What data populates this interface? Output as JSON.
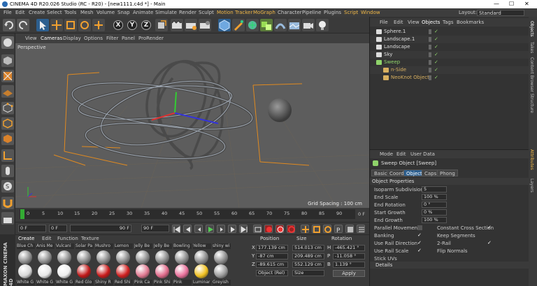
{
  "window": {
    "title": "CINEMA 4D R20.026 Studio (RC - R20) - [new1111.c4d *] - Main",
    "minimize": "—",
    "maximize": "☐",
    "close": "✕"
  },
  "menubar": {
    "items": [
      "File",
      "Edit",
      "Create",
      "Select",
      "Tools",
      "Mesh",
      "Volume",
      "Snap",
      "Animate",
      "Simulate",
      "Render",
      "Sculpt",
      "Motion Tracker",
      "MoGraph",
      "Character",
      "Pipeline",
      "Plugins",
      "Script",
      "Window"
    ],
    "layout_label": "Layout:",
    "layout_value": "Standard"
  },
  "toolbar": {
    "axis_x": "X",
    "axis_y": "Y",
    "axis_z": "Z"
  },
  "viewport": {
    "menu": [
      "View",
      "Cameras",
      "Display",
      "Options",
      "Filter",
      "Panel",
      "ProRender"
    ],
    "label": "Perspective",
    "grid_spacing": "Grid Spacing : 100 cm"
  },
  "timeline": {
    "ticks": [
      "0",
      "5",
      "10",
      "15",
      "20",
      "25",
      "30",
      "35",
      "40",
      "45",
      "50",
      "55",
      "60",
      "65",
      "70",
      "75",
      "80",
      "85",
      "90"
    ],
    "end_frame": "0 F"
  },
  "controls": {
    "current_frame": "0 F",
    "start_frame": "0 F",
    "preview_end": "90 F",
    "end_frame": "90 F"
  },
  "materials": {
    "menu": [
      "Create",
      "Edit",
      "Function",
      "Texture"
    ],
    "top_row": [
      "Blue Ch",
      "Anis Me",
      "Vulcani",
      "Solar Pa",
      "Mushro",
      "Lemon",
      "Jelly Be",
      "Jelly Be",
      "Bowling",
      "Yellow",
      "shiny wi"
    ],
    "bottom_row": [
      "White G",
      "White G",
      "White G",
      "Red Glo",
      "Shiny R",
      "Red Shi",
      "Pink Ca",
      "Pink Shi",
      "Pink",
      "Luminar",
      "Greyish"
    ],
    "colors": [
      "#d8d8d8",
      "#e8e8e8",
      "#eeeeee",
      "#c01818",
      "#c81a1a",
      "#d02020",
      "#e07890",
      "#e06a8a",
      "#e8709a",
      "#f0c020",
      "#9a9a9a"
    ],
    "brand": "MAXON CINEMA 4D"
  },
  "coords": {
    "position_label": "Position",
    "size_label": "Size",
    "rotation_label": "Rotation",
    "x_label": "X",
    "y_label": "Y",
    "z_label": "Z",
    "h_label": "H",
    "p_label": "P",
    "b_label": "B",
    "px": "177.139 cm",
    "py": "-87 cm",
    "pz": "-89.615 cm",
    "sx": "514.013 cm",
    "sy": "209.489 cm",
    "sz": "552.129 cm",
    "rh": "-465.421 °",
    "rp": "-11.058 °",
    "rb": "1.139 °",
    "mode": "Object (Rel)",
    "size_mode": "Size",
    "apply": "Apply"
  },
  "objects": {
    "menu": [
      "File",
      "Edit",
      "View",
      "Objects",
      "Tags",
      "Bookmarks"
    ],
    "rows": [
      {
        "name": "Sphere.1",
        "color": "#dddddd"
      },
      {
        "name": "Landscape.1",
        "color": "#dddddd"
      },
      {
        "name": "Landscape",
        "color": "#dddddd"
      },
      {
        "name": "Sky",
        "color": "#dddddd"
      },
      {
        "name": "Sweep",
        "color": "#8fd36a"
      },
      {
        "name": "n-Side",
        "color": "#d8b060"
      },
      {
        "name": "NeoKnot Object",
        "color": "#d8b060"
      }
    ]
  },
  "attributes": {
    "menu": [
      "Mode",
      "Edit",
      "User Data"
    ],
    "object_title": "Sweep Object [Sweep]",
    "tabs": [
      "Basic",
      "Coord.",
      "Object",
      "Caps",
      "Phong"
    ],
    "section": "Object Properties",
    "rows": [
      {
        "label": "Isoparm Subdivision",
        "value": "5"
      },
      {
        "label": "End Scale",
        "value": "100 %"
      },
      {
        "label": "End Rotation",
        "value": "0 °"
      },
      {
        "label": "Start Growth",
        "value": "0 %"
      },
      {
        "label": "End Growth",
        "value": "100 %"
      }
    ],
    "checks_left": [
      "Parallel Movement",
      "Banking",
      "Use Rail Direction",
      "Use Rail Scale",
      "Stick UVs"
    ],
    "checks_right": [
      "Constant Cross Section",
      "Keep Segments",
      "2-Rail",
      "Flip Normals"
    ],
    "details": "Details"
  },
  "right_strip": [
    "Objects",
    "Takes",
    "Content Browser",
    "Structure",
    "Attributes",
    "Layers"
  ]
}
